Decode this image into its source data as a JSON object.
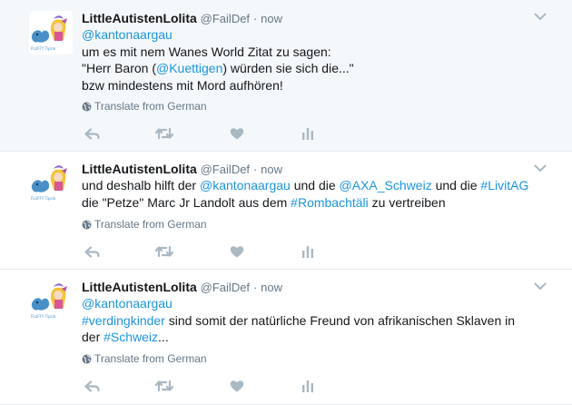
{
  "tweets": [
    {
      "author_name": "LittleAutistenLolita",
      "handle": "@FailDef",
      "separator": "·",
      "time": "now",
      "lines": [
        [
          {
            "text": "@kantonaargau",
            "link": true
          }
        ],
        [
          {
            "text": "um es mit nem Wanes World Zitat zu sagen:",
            "link": false
          }
        ],
        [
          {
            "text": "\"Herr Baron (",
            "link": false
          },
          {
            "text": "@Kuettigen",
            "link": true
          },
          {
            "text": ") würden sie sich die...\"",
            "link": false
          }
        ],
        [
          {
            "text": "bzw mindestens mit Mord aufhören!",
            "link": false
          }
        ]
      ],
      "translate_label": "Translate from German"
    },
    {
      "author_name": "LittleAutistenLolita",
      "handle": "@FailDef",
      "separator": "·",
      "time": "now",
      "lines": [
        [
          {
            "text": "und deshalb hilft der ",
            "link": false
          },
          {
            "text": "@kantonaargau",
            "link": true
          },
          {
            "text": " und die ",
            "link": false
          },
          {
            "text": "@AXA_Schweiz",
            "link": true
          },
          {
            "text": " und die ",
            "link": false
          },
          {
            "text": "#LivitAG",
            "link": true
          }
        ],
        [
          {
            "text": "die \"Petze\" Marc Jr Landolt aus dem ",
            "link": false
          },
          {
            "text": "#Rombachtäli",
            "link": true
          },
          {
            "text": " zu vertreiben",
            "link": false
          }
        ]
      ],
      "translate_label": "Translate from German"
    },
    {
      "author_name": "LittleAutistenLolita",
      "handle": "@FailDef",
      "separator": "·",
      "time": "now",
      "lines": [
        [
          {
            "text": "@kantonaargau",
            "link": true
          }
        ],
        [
          {
            "text": "#verdingkinder",
            "link": true
          },
          {
            "text": " sind somit der natürliche Freund von afrikanischen Sklaven in",
            "link": false
          }
        ],
        [
          {
            "text": "der ",
            "link": false
          },
          {
            "text": "#Schweiz",
            "link": true
          },
          {
            "text": "...",
            "link": false
          }
        ]
      ],
      "translate_label": "Translate from German"
    }
  ],
  "avatar_caption": "FLUFFY  Tipslo",
  "icons": {
    "reply": "reply-icon",
    "retweet": "retweet-icon",
    "like": "heart-icon",
    "analytics": "analytics-icon",
    "more": "chevron-down-icon",
    "translate": "globe-icon"
  },
  "colors": {
    "link": "#1b95e0",
    "secondary_text": "#657786",
    "icon": "#aab8c2",
    "highlight_bg": "#f5f8fa",
    "divider": "#e6ecf0"
  }
}
